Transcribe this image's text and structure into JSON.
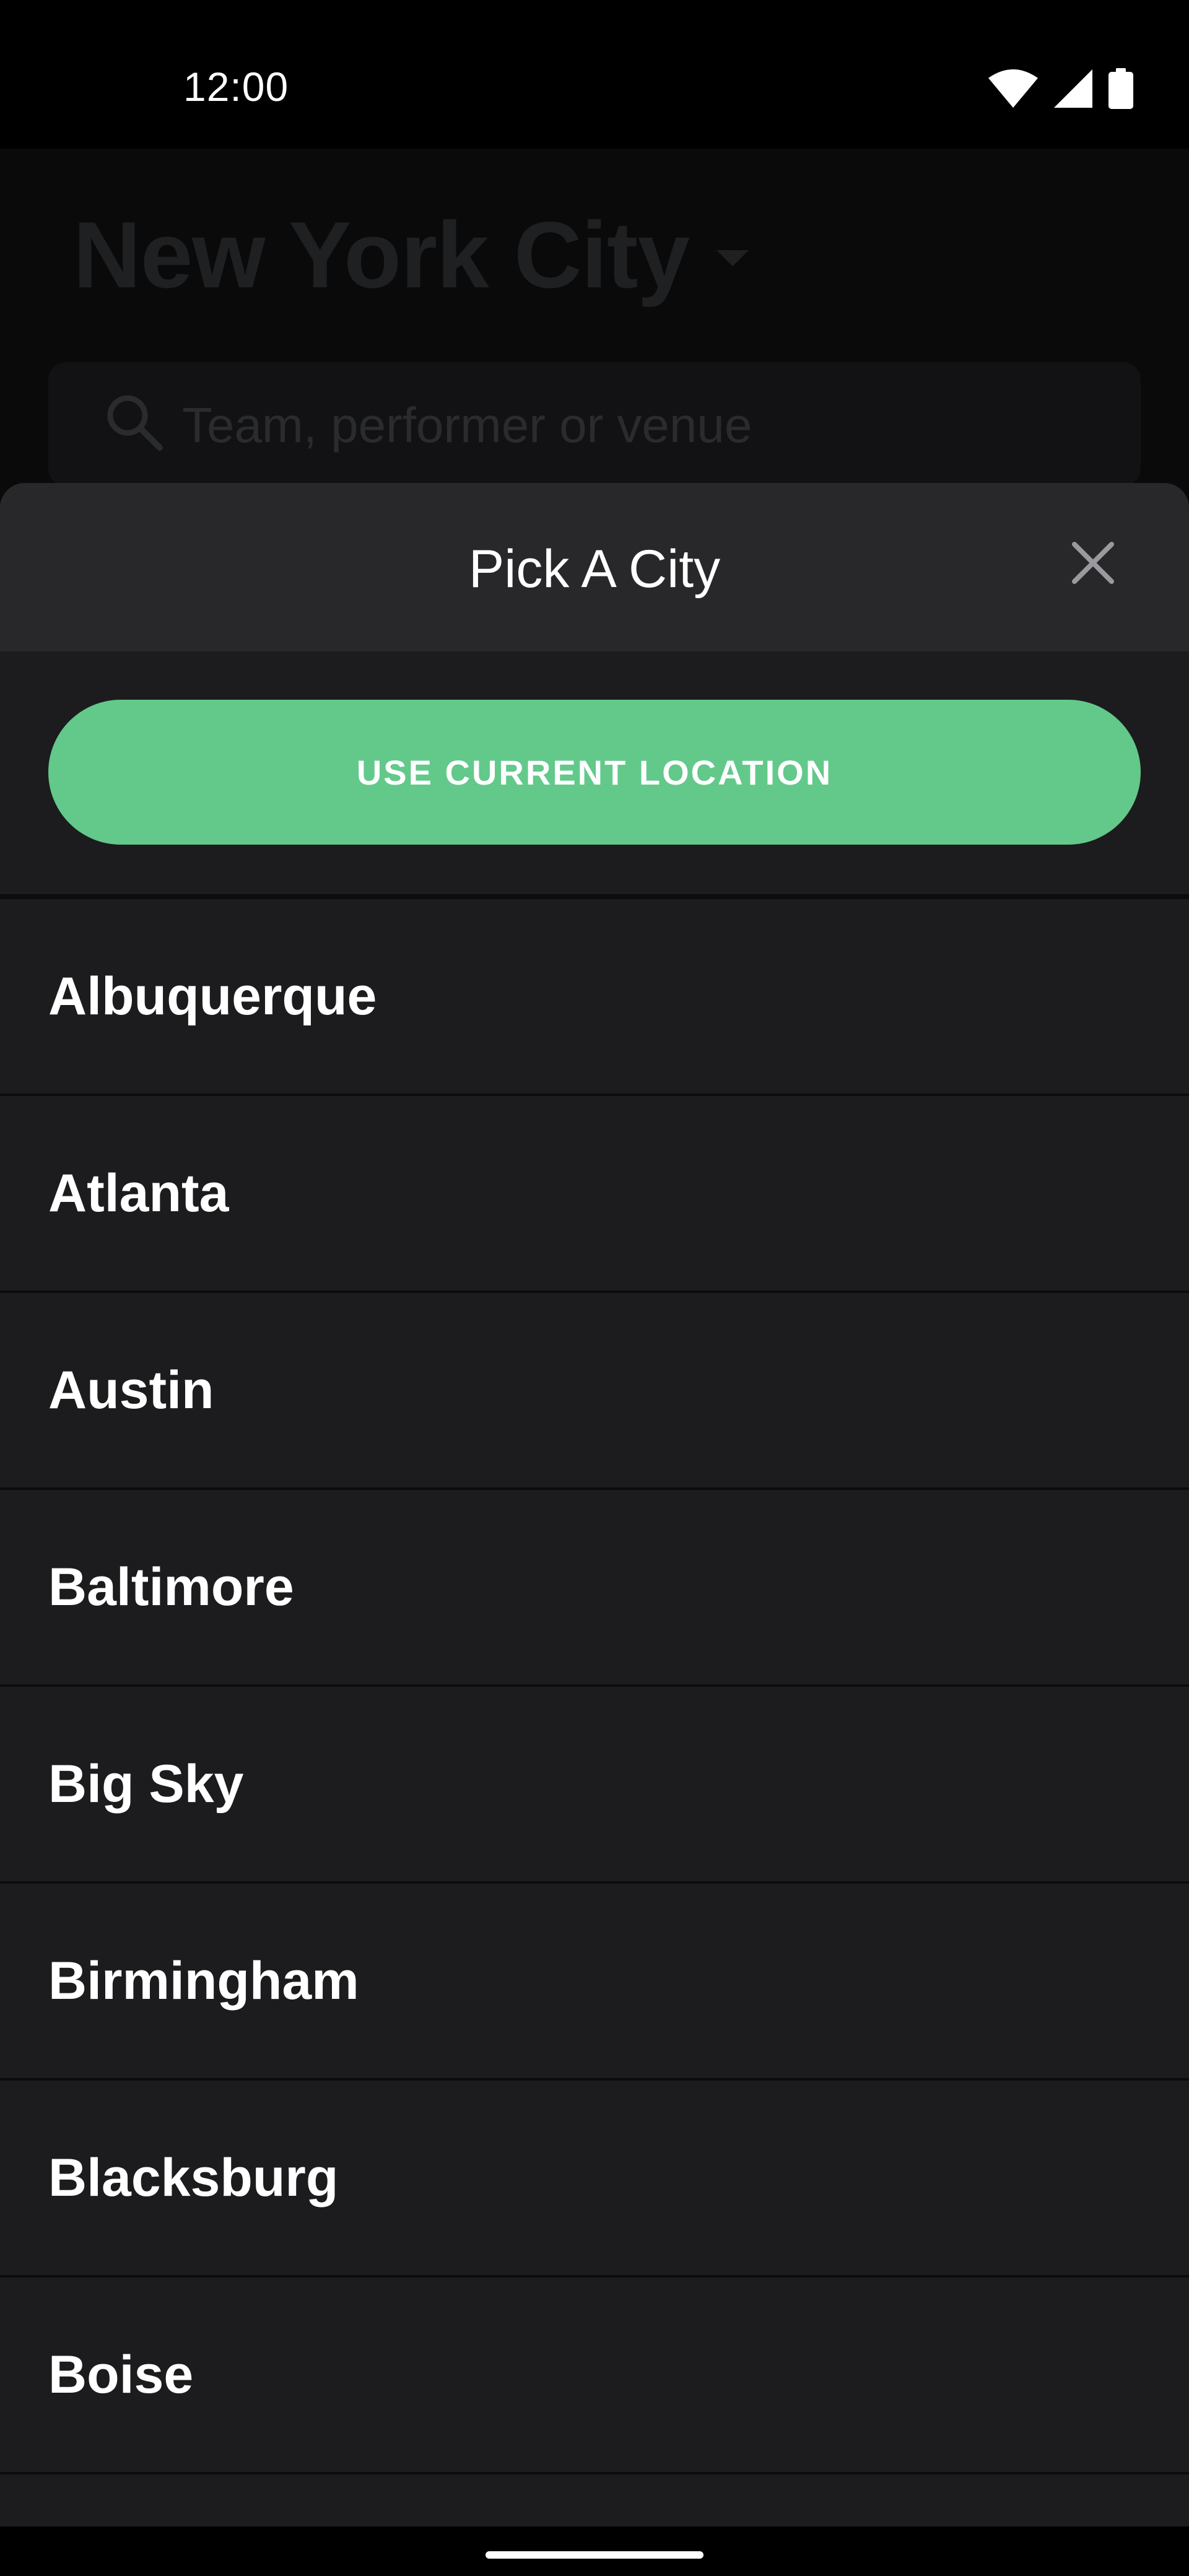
{
  "status_bar": {
    "time": "12:00",
    "icons": [
      "wifi-icon",
      "signal-icon",
      "battery-icon"
    ]
  },
  "background_page": {
    "title": "New York City",
    "search_placeholder": "Team, performer or venue"
  },
  "sheet": {
    "title": "Pick A City",
    "close_icon": "close-icon",
    "location_button_label": "USE CURRENT LOCATION",
    "cities": [
      "Albuquerque",
      "Atlanta",
      "Austin",
      "Baltimore",
      "Big Sky",
      "Birmingham",
      "Blacksburg",
      "Boise"
    ]
  },
  "colors": {
    "accent": "#62c98b",
    "sheet_bg": "#1c1c1e",
    "header_bg": "#28282b"
  }
}
